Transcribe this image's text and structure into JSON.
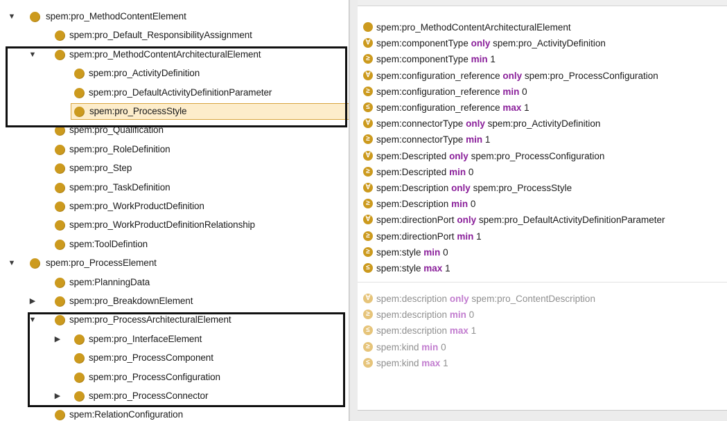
{
  "colors": {
    "class_dot": "#cc9a1e",
    "inherited_dot": "#e6c47a",
    "keyword": "#8a1f9a",
    "inherited_keyword": "#c27dcf",
    "selection_bg": "#fdedcb",
    "selection_border": "#d8a53e",
    "highlight_box": "#111111"
  },
  "tree": {
    "items": [
      {
        "label": "spem:pro_MethodContentElement",
        "toggle": "▼"
      },
      {
        "label": "spem:pro_Default_ResponsibilityAssignment",
        "toggle": ""
      },
      {
        "label": "spem:pro_MethodContentArchitecturalElement",
        "toggle": "▼"
      },
      {
        "label": "spem:pro_ActivityDefinition",
        "toggle": ""
      },
      {
        "label": "spem:pro_DefaultActivityDefinitionParameter",
        "toggle": ""
      },
      {
        "label": "spem:pro_ProcessStyle",
        "toggle": "",
        "selected": true
      },
      {
        "label": "spem:pro_Qualification",
        "toggle": ""
      },
      {
        "label": "spem:pro_RoleDefinition",
        "toggle": ""
      },
      {
        "label": "spem:pro_Step",
        "toggle": ""
      },
      {
        "label": "spem:pro_TaskDefinition",
        "toggle": ""
      },
      {
        "label": "spem:pro_WorkProductDefinition",
        "toggle": ""
      },
      {
        "label": "spem:pro_WorkProductDefinitionRelationship",
        "toggle": ""
      },
      {
        "label": "spem:ToolDefintion",
        "toggle": ""
      },
      {
        "label": "spem:pro_ProcessElement",
        "toggle": "▼"
      },
      {
        "label": "spem:PlanningData",
        "toggle": ""
      },
      {
        "label": "spem:pro_BreakdownElement",
        "toggle": "▶"
      },
      {
        "label": "spem:pro_ProcessArchitecturalElement",
        "toggle": "▼"
      },
      {
        "label": "spem:pro_InterfaceElement",
        "toggle": "▶"
      },
      {
        "label": "spem:pro_ProcessComponent",
        "toggle": ""
      },
      {
        "label": "spem:pro_ProcessConfiguration",
        "toggle": ""
      },
      {
        "label": "spem:pro_ProcessConnector",
        "toggle": "▶"
      },
      {
        "label": "spem:RelationConfiguration",
        "toggle": ""
      }
    ]
  },
  "axioms": {
    "direct": [
      {
        "icon": "",
        "subject": "spem:pro_MethodContentArchitecturalElement",
        "keyword": "",
        "object": ""
      },
      {
        "icon": "∀",
        "subject": "spem:componentType",
        "keyword": "only",
        "object": "spem:pro_ActivityDefinition"
      },
      {
        "icon": "≥",
        "subject": "spem:componentType",
        "keyword": "min",
        "object": "1"
      },
      {
        "icon": "∀",
        "subject": "spem:configuration_reference",
        "keyword": "only",
        "object": "spem:pro_ProcessConfiguration"
      },
      {
        "icon": "≥",
        "subject": "spem:configuration_reference",
        "keyword": "min",
        "object": "0"
      },
      {
        "icon": "≤",
        "subject": "spem:configuration_reference",
        "keyword": "max",
        "object": "1"
      },
      {
        "icon": "∀",
        "subject": "spem:connectorType",
        "keyword": "only",
        "object": "spem:pro_ActivityDefinition"
      },
      {
        "icon": "≥",
        "subject": "spem:connectorType",
        "keyword": "min",
        "object": "1"
      },
      {
        "icon": "∀",
        "subject": "spem:Descripted",
        "keyword": "only",
        "object": "spem:pro_ProcessConfiguration"
      },
      {
        "icon": "≥",
        "subject": "spem:Descripted",
        "keyword": "min",
        "object": "0"
      },
      {
        "icon": "∀",
        "subject": "spem:Description",
        "keyword": "only",
        "object": "spem:pro_ProcessStyle"
      },
      {
        "icon": "≥",
        "subject": "spem:Description",
        "keyword": "min",
        "object": "0"
      },
      {
        "icon": "∀",
        "subject": "spem:directionPort",
        "keyword": "only",
        "object": "spem:pro_DefaultActivityDefinitionParameter"
      },
      {
        "icon": "≥",
        "subject": "spem:directionPort",
        "keyword": "min",
        "object": "1"
      },
      {
        "icon": "≥",
        "subject": "spem:style",
        "keyword": "min",
        "object": "0"
      },
      {
        "icon": "≤",
        "subject": "spem:style",
        "keyword": "max",
        "object": "1"
      }
    ],
    "inherited": [
      {
        "icon": "∀",
        "subject": "spem:description",
        "keyword": "only",
        "object": "spem:pro_ContentDescription"
      },
      {
        "icon": "≥",
        "subject": "spem:description",
        "keyword": "min",
        "object": "0"
      },
      {
        "icon": "≤",
        "subject": "spem:description",
        "keyword": "max",
        "object": "1"
      },
      {
        "icon": "≥",
        "subject": "spem:kind",
        "keyword": "min",
        "object": "0"
      },
      {
        "icon": "≤",
        "subject": "spem:kind",
        "keyword": "max",
        "object": "1"
      }
    ]
  }
}
